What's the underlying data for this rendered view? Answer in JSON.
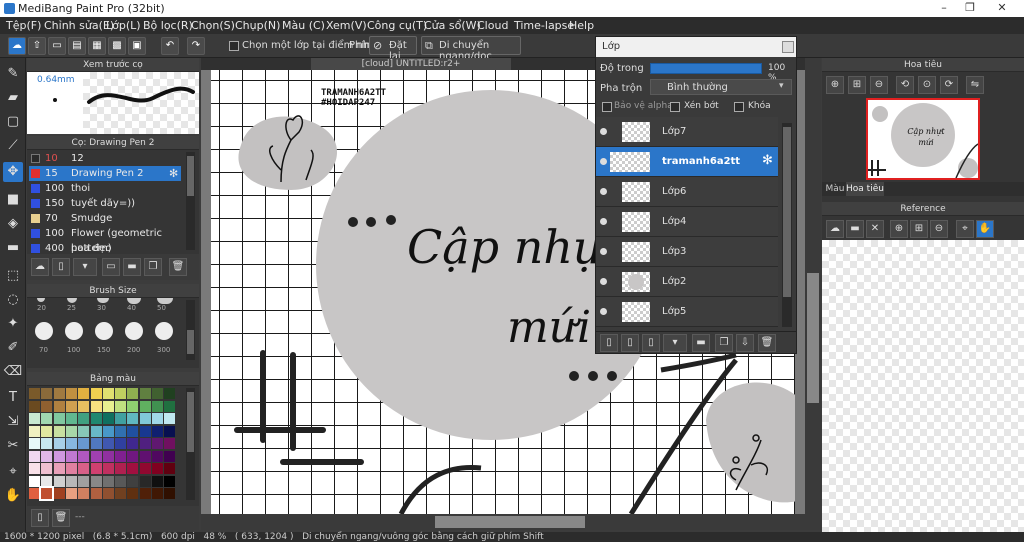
{
  "window": {
    "title": "MediBang Paint Pro (32bit)"
  },
  "menu": [
    "Tệp(F)",
    "Chỉnh sửa(E)",
    "Lớp(L)",
    "Bộ lọc(R)",
    "Chọn(S)",
    "Chụp(N)",
    "Màu (C)",
    "Xem(V)",
    "Công cụ(T)",
    "Cửa sổ(W)",
    "Cloud",
    "Time-lapse",
    "Help"
  ],
  "toolbar": {
    "select_layer_label": "Chọn một lớp tại điểm nhấp",
    "phim_label": "Phím",
    "reset_label": "Đặt lại",
    "move_label": "Di chuyển ngang/dọc"
  },
  "brush_preview": {
    "title": "Xem trước cọ",
    "size": "0.64mm"
  },
  "brush_panel": {
    "title": "Cọ: Drawing Pen 2",
    "items": [
      {
        "size": "10",
        "name": "12",
        "color": "#2a2a2a",
        "selected": false
      },
      {
        "size": "15",
        "name": "Drawing Pen 2",
        "color": "#e03030",
        "selected": true
      },
      {
        "size": "100",
        "name": "thoi",
        "color": "#3050e0",
        "selected": false
      },
      {
        "size": "150",
        "name": "tuyết dãy=))",
        "color": "#3050e0",
        "selected": false
      },
      {
        "size": "70",
        "name": "Smudge",
        "color": "#e8d090",
        "selected": false
      },
      {
        "size": "100",
        "name": "Flower (geometric pattern)",
        "color": "#3050e0",
        "selected": false
      },
      {
        "size": "400",
        "name": "hoa đẹo",
        "color": "#3050e0",
        "selected": false
      }
    ]
  },
  "brush_size_panel": {
    "title": "Brush Size",
    "row1": [
      "20",
      "25",
      "30",
      "40",
      "50"
    ],
    "row2": [
      "70",
      "100",
      "150",
      "200",
      "300"
    ]
  },
  "palette_panel": {
    "title": "Bảng màu",
    "footer": "---"
  },
  "canvas": {
    "tab": "[cloud] UNTITLED:r2+",
    "watermark1": "TRAMANH6A2TT",
    "watermark2": "#HOIDAP247",
    "text1": "Cập nhựt",
    "text2": "mứi"
  },
  "layer_panel": {
    "title": "Lớp",
    "opacity_label": "Độ trong",
    "opacity_value": "100 %",
    "blend_label": "Pha trộn",
    "blend_value": "Bình thường",
    "protect_alpha": "Bảo vệ alpha",
    "clip": "Xén bớt",
    "lock": "Khóa",
    "layers": [
      {
        "name": "Lớp7",
        "selected": false
      },
      {
        "name": "tramanh6a2tt",
        "selected": true
      },
      {
        "name": "Lớp6",
        "selected": false
      },
      {
        "name": "Lớp4",
        "selected": false
      },
      {
        "name": "Lớp3",
        "selected": false
      },
      {
        "name": "Lớp2",
        "selected": false
      },
      {
        "name": "Lớp5",
        "selected": false
      }
    ]
  },
  "navigator": {
    "title": "Hoa tiêu",
    "tab_color": "Màu",
    "tab_nav": "Hoa tiêu",
    "preview_text": "Cập nhựt mứi"
  },
  "reference": {
    "title": "Reference"
  },
  "status": {
    "text": "1600 * 1200 pixel   (6.8 * 5.1cm)   600 dpi   48 %   ( 633, 1204 )   Di chuyển ngang/vuông góc bằng cách giữ phím Shift"
  }
}
